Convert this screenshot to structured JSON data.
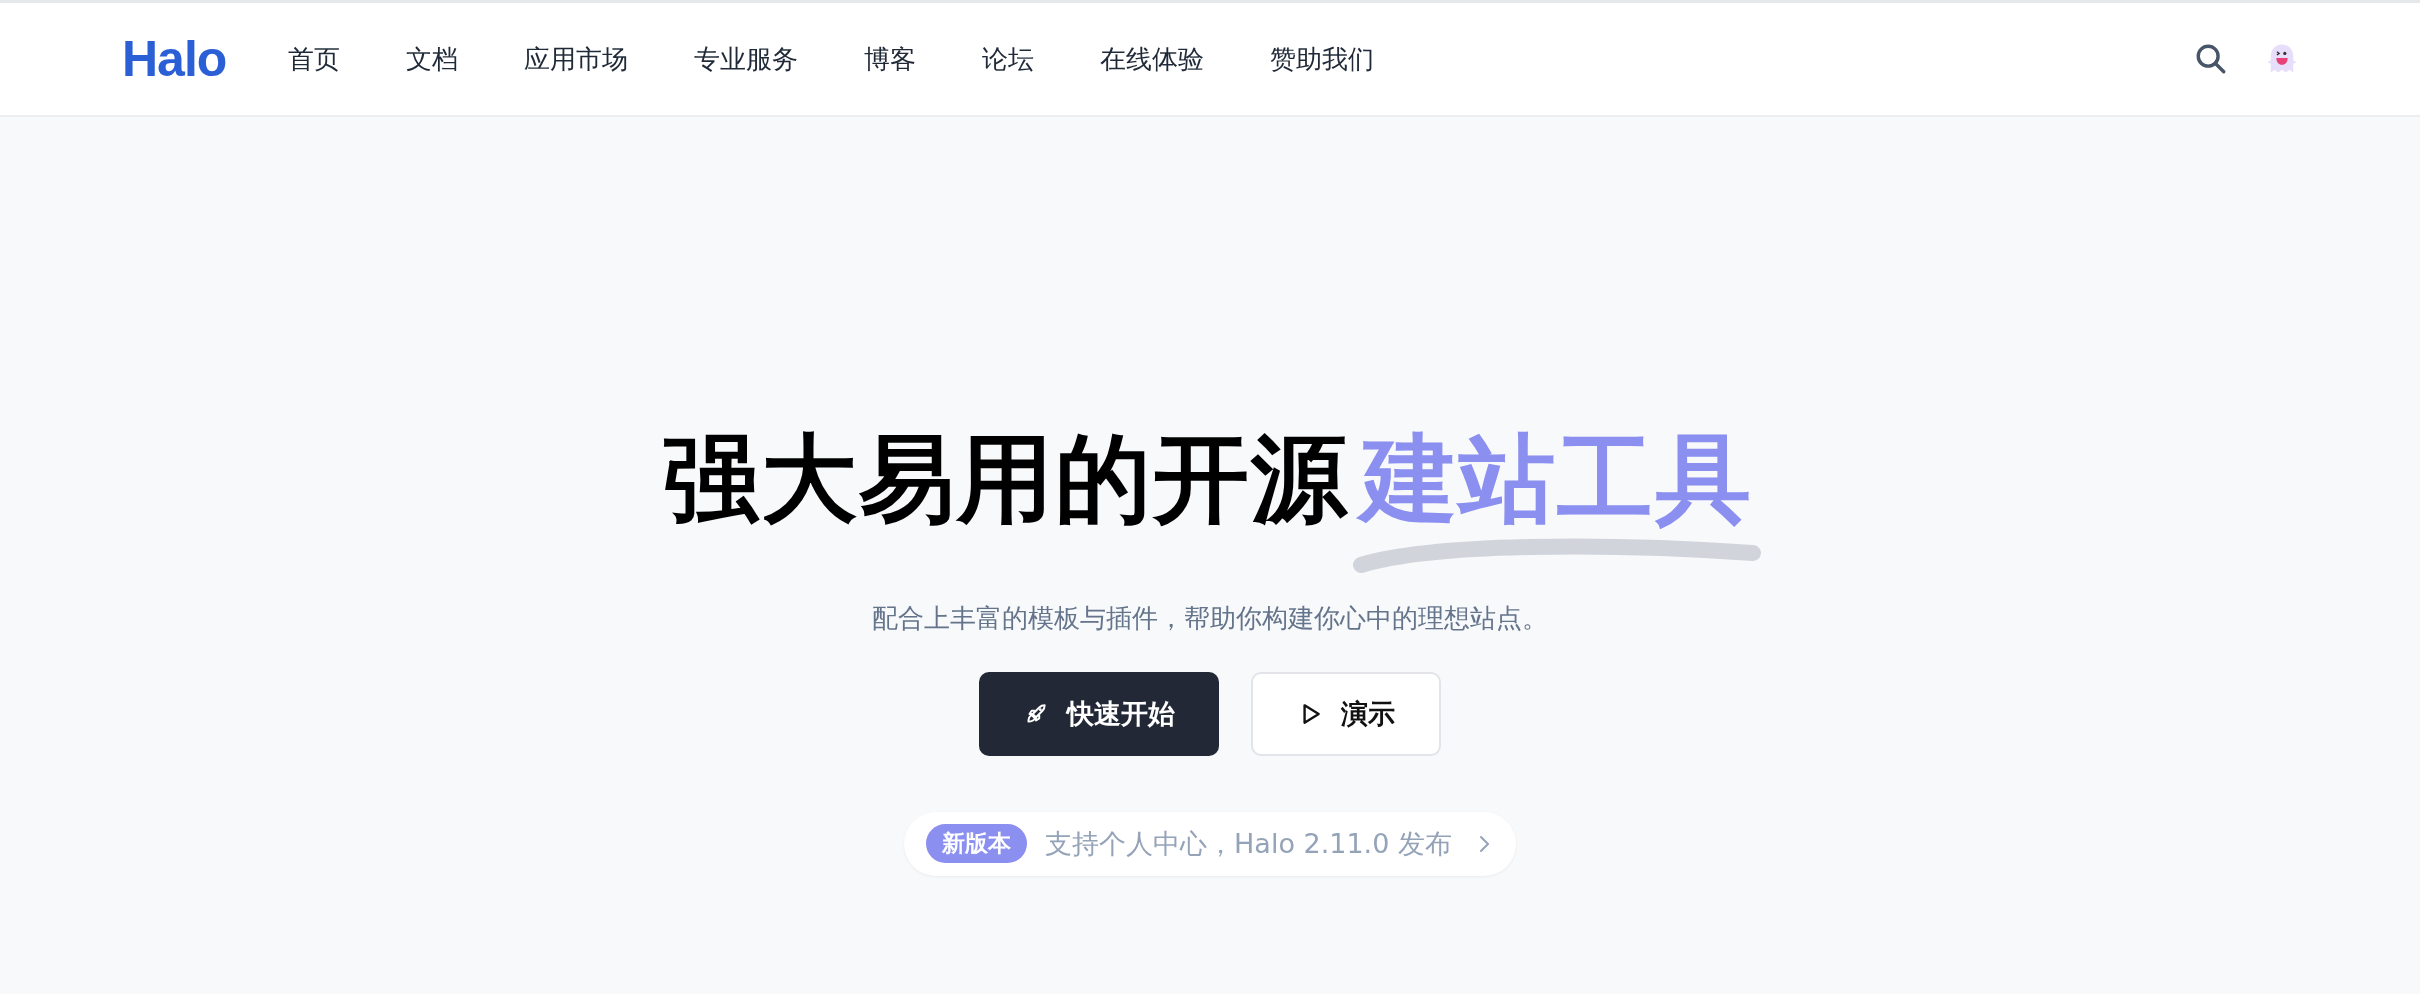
{
  "header": {
    "logo": "Halo",
    "nav": [
      {
        "label": "首页"
      },
      {
        "label": "文档"
      },
      {
        "label": "应用市场"
      },
      {
        "label": "专业服务"
      },
      {
        "label": "博客"
      },
      {
        "label": "论坛"
      },
      {
        "label": "在线体验"
      },
      {
        "label": "赞助我们"
      }
    ]
  },
  "hero": {
    "title": "强大易用的开源",
    "title_highlight": "建站工具",
    "subtitle": "配合上丰富的模板与插件，帮助你构建你心中的理想站点。",
    "buttons": [
      {
        "label": "快速开始",
        "kind": "primary"
      },
      {
        "label": "演示",
        "kind": "secondary"
      }
    ],
    "announcement": {
      "badge": "新版本",
      "text": "支持个人中心，Halo 2.11.0 发布"
    }
  }
}
